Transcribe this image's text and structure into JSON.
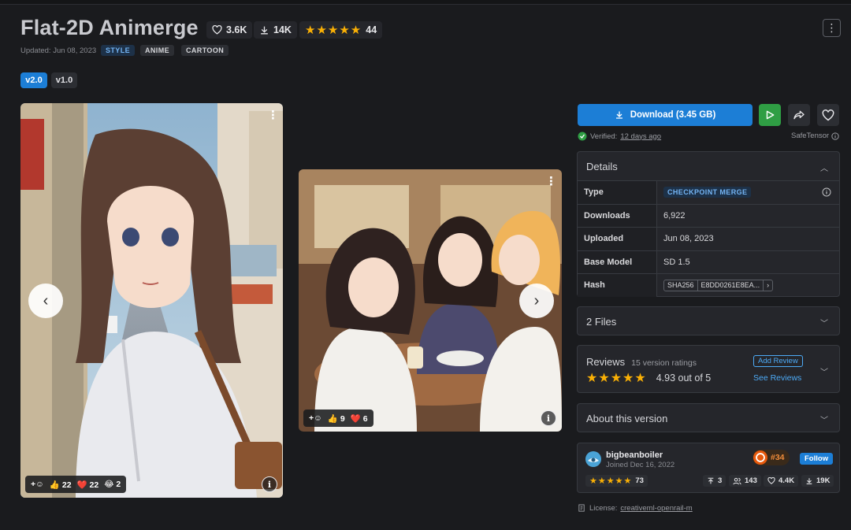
{
  "model": {
    "title": "Flat-2D Animerge",
    "likes": "3.6K",
    "downloads": "14K",
    "rating_stars": "★★★★★",
    "rating_count": "44",
    "updated": "Updated: Jun 08, 2023",
    "tags": [
      "STYLE",
      "ANIME",
      "CARTOON"
    ]
  },
  "versions": [
    "v2.0",
    "v1.0"
  ],
  "gallery": {
    "image1": {
      "thumbs": "22",
      "hearts": "22",
      "laughs": "2"
    },
    "image2": {
      "thumbs": "9",
      "hearts": "6"
    },
    "prev_glyph": "‹",
    "next_glyph": "›",
    "info_glyph": "i",
    "menu_glyph": "⋮"
  },
  "actions": {
    "download_label": "Download (3.45 GB)",
    "verified_prefix": "Verified:",
    "verified_when": "12 days ago",
    "safetensor": "SafeTensor"
  },
  "details": {
    "heading": "Details",
    "rows": {
      "type_label": "Type",
      "type_value": "CHECKPOINT MERGE",
      "downloads_label": "Downloads",
      "downloads_value": "6,922",
      "uploaded_label": "Uploaded",
      "uploaded_value": "Jun 08, 2023",
      "base_label": "Base Model",
      "base_value": "SD 1.5",
      "hash_label": "Hash",
      "hash_algo": "SHA256",
      "hash_value": "E8DD0261E8EA...",
      "hash_more": "›"
    }
  },
  "files": {
    "heading": "2 Files"
  },
  "reviews": {
    "heading": "Reviews",
    "sub": "15 version ratings",
    "stars": "★★★★★",
    "score": "4.93 out of 5",
    "add_label": "Add Review",
    "see_label": "See Reviews"
  },
  "about": {
    "heading": "About this version"
  },
  "creator": {
    "name": "bigbeanboiler",
    "joined": "Joined Dec 16, 2022",
    "rank": "#34",
    "follow_label": "Follow",
    "stars": "★★★★★",
    "rating_count": "73",
    "uploads": "3",
    "followers": "143",
    "likes": "4.4K",
    "downloads": "19K"
  },
  "license": {
    "prefix": "License:",
    "name": "creativeml-openrail-m"
  },
  "colors": {
    "accent": "#1c7ed6",
    "success": "#2f9e44",
    "star": "#fab005",
    "bg": "#1a1b1e",
    "panel": "#25262b"
  }
}
